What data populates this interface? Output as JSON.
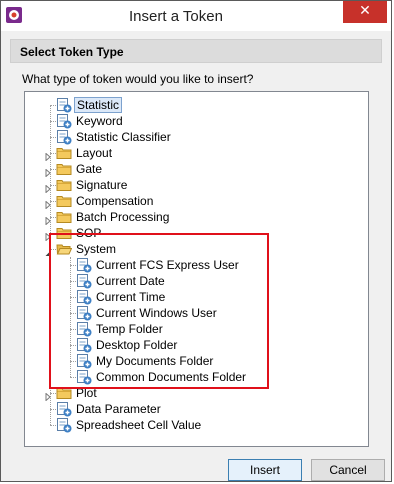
{
  "window": {
    "title": "Insert a Token",
    "close_glyph": "✕",
    "app_icon": "fcs-express-app-icon"
  },
  "section": {
    "header": "Select Token Type",
    "question": "What type of token would you like to insert?"
  },
  "tree": {
    "items": [
      {
        "label": "Statistic",
        "icon": "token-icon",
        "level": 0,
        "expander": "none",
        "selected": true
      },
      {
        "label": "Keyword",
        "icon": "token-icon",
        "level": 0,
        "expander": "none"
      },
      {
        "label": "Statistic Classifier",
        "icon": "token-icon",
        "level": 0,
        "expander": "none"
      },
      {
        "label": "Layout",
        "icon": "folder-icon",
        "level": 0,
        "expander": "collapsed"
      },
      {
        "label": "Gate",
        "icon": "folder-icon",
        "level": 0,
        "expander": "collapsed"
      },
      {
        "label": "Signature",
        "icon": "folder-icon",
        "level": 0,
        "expander": "collapsed"
      },
      {
        "label": "Compensation",
        "icon": "folder-icon",
        "level": 0,
        "expander": "collapsed"
      },
      {
        "label": "Batch Processing",
        "icon": "folder-icon",
        "level": 0,
        "expander": "collapsed"
      },
      {
        "label": "SOP",
        "icon": "folder-icon",
        "level": 0,
        "expander": "collapsed"
      },
      {
        "label": "System",
        "icon": "folder-open-icon",
        "level": 0,
        "expander": "expanded"
      },
      {
        "label": "Current FCS Express User",
        "icon": "token-icon",
        "level": 1,
        "expander": "none"
      },
      {
        "label": "Current Date",
        "icon": "token-icon",
        "level": 1,
        "expander": "none"
      },
      {
        "label": "Current Time",
        "icon": "token-icon",
        "level": 1,
        "expander": "none"
      },
      {
        "label": "Current Windows User",
        "icon": "token-icon",
        "level": 1,
        "expander": "none"
      },
      {
        "label": "Temp Folder",
        "icon": "token-icon",
        "level": 1,
        "expander": "none"
      },
      {
        "label": "Desktop Folder",
        "icon": "token-icon",
        "level": 1,
        "expander": "none"
      },
      {
        "label": "My Documents Folder",
        "icon": "token-icon",
        "level": 1,
        "expander": "none"
      },
      {
        "label": "Common Documents Folder",
        "icon": "token-icon",
        "level": 1,
        "expander": "none"
      },
      {
        "label": "Plot",
        "icon": "folder-icon",
        "level": 0,
        "expander": "collapsed"
      },
      {
        "label": "Data Parameter",
        "icon": "token-icon",
        "level": 0,
        "expander": "none"
      },
      {
        "label": "Spreadsheet Cell Value",
        "icon": "token-icon",
        "level": 0,
        "expander": "none"
      }
    ]
  },
  "buttons": {
    "insert": "Insert",
    "cancel": "Cancel"
  },
  "colors": {
    "highlight_border": "#e0101a",
    "selection_bg": "#dbe8f8",
    "close_button": "#c7312a",
    "folder": "#f4c95d"
  }
}
